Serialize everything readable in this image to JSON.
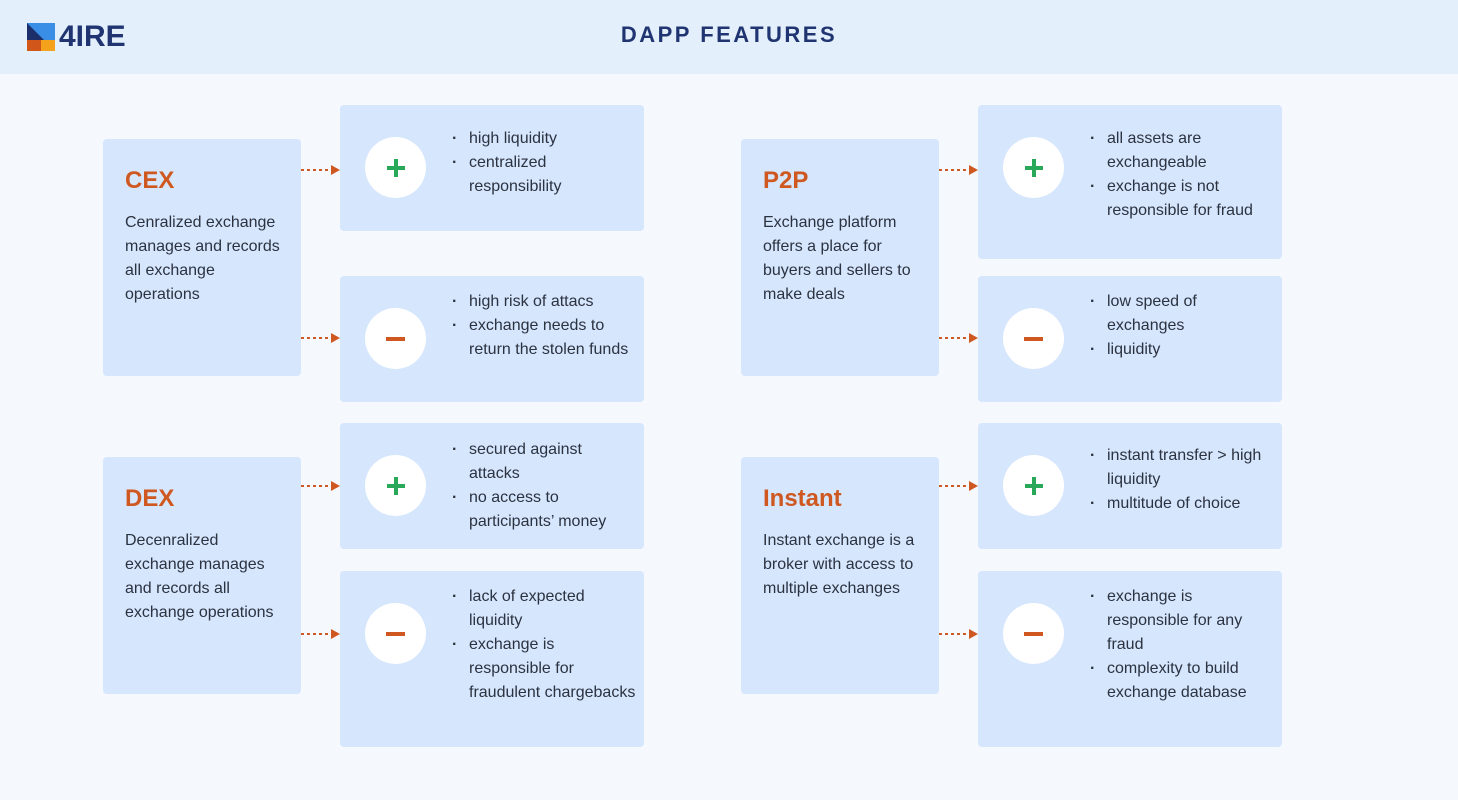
{
  "header": {
    "logo_text": "4IRE",
    "title": "DAPP FEATURES"
  },
  "colors": {
    "accent_orange": "#cf5820",
    "plus_green": "#29a85a",
    "navy": "#1f3470",
    "box_blue": "#d6e6fd"
  },
  "icons": {
    "pros": "plus-icon",
    "cons": "minus-icon",
    "connector": "dotted-arrow-icon"
  },
  "features": [
    {
      "title": "CEX",
      "description": "Cenralized exchange manages and records all exchange operations",
      "pros": [
        "high liquidity",
        "centralized responsibility"
      ],
      "cons": [
        "high risk of attacs",
        "exchange needs to return the stolen funds"
      ]
    },
    {
      "title": "P2P",
      "description": "Exchange platform offers a place for buyers and sellers to make deals",
      "pros": [
        "all assets are exchangeable",
        "exchange is not responsible for fraud"
      ],
      "cons": [
        "low speed of exchanges",
        "liquidity"
      ]
    },
    {
      "title": "DEX",
      "description": "Decenralized exchange manages and records all exchange operations",
      "pros": [
        "secured against attacks",
        "no access to participants’ money"
      ],
      "cons": [
        "lack of expected liquidity",
        "exchange is responsible for fraudulent chargebacks"
      ]
    },
    {
      "title": "Instant",
      "description": "Instant exchange is a broker with access to multiple exchanges",
      "pros": [
        "instant transfer > high liquidity",
        "multitude of choice"
      ],
      "cons": [
        "exchange is responsible for any fraud",
        "complexity to build exchange database"
      ]
    }
  ]
}
